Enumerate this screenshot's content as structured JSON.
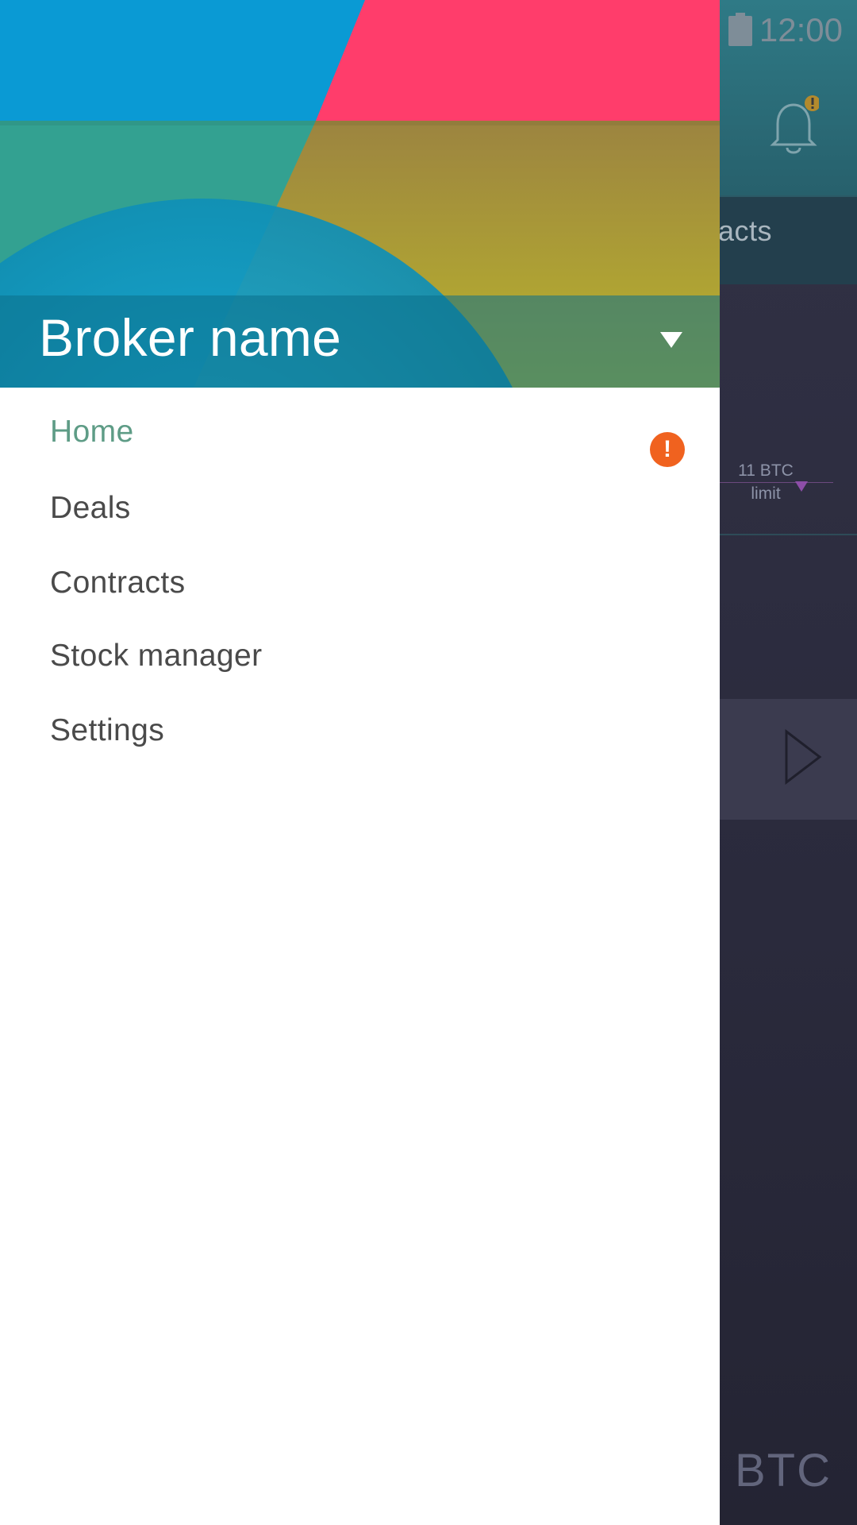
{
  "status_bar": {
    "time": "12:00",
    "battery_icon": "battery-icon"
  },
  "background_app": {
    "notification_icon": "bell-icon",
    "tab_label_partial": "acts",
    "limit_amount": "11 BTC",
    "limit_label": "limit",
    "play_icon": "play-icon",
    "currency": "BTC"
  },
  "drawer": {
    "broker_name": "Broker name",
    "dropdown_icon": "caret-down-icon",
    "menu": {
      "items": [
        {
          "label": "Home",
          "active": true,
          "alert": "!"
        },
        {
          "label": "Deals"
        },
        {
          "label": "Contracts"
        },
        {
          "label": "Stock manager"
        },
        {
          "label": "Settings"
        }
      ]
    }
  },
  "colors": {
    "active_item": "#5e9c86",
    "menu_text": "#4a4a4a",
    "alert_badge": "#f0621f",
    "header_blue": "#0a9ad4",
    "header_pink": "#ff3d6b",
    "header_olive": "#b7b22d"
  }
}
